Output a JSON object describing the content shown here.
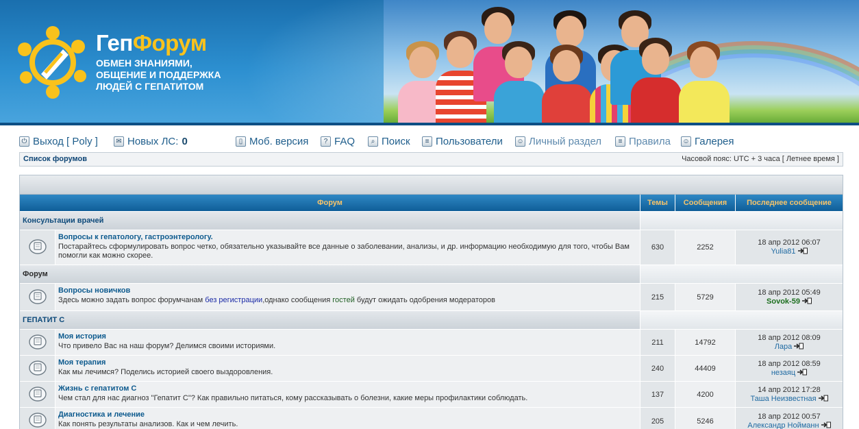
{
  "header": {
    "logo_prefix": "Геп",
    "logo_accent": "Форум",
    "tagline": [
      "ОБМЕН ЗНАНИЯМИ,",
      "ОБЩЕНИЕ И ПОДДЕРЖКА",
      "ЛЮДЕЙ С ГЕПАТИТОМ"
    ],
    "colors": {
      "brand_blue": "#1a6fae",
      "accent_yellow": "#f9c21c"
    }
  },
  "nav": {
    "logout_label": "Выход [ Poly ]",
    "pm_label": "Новых ЛС:",
    "pm_count": "0",
    "mobile_label": "Моб. версия",
    "faq_label": "FAQ",
    "search_label": "Поиск",
    "users_label": "Пользователи",
    "personal_label": "Личный раздел",
    "rules_label": "Правила",
    "gallery_label": "Галерея"
  },
  "breadcrumb": {
    "forum_list": "Список форумов",
    "timezone": "Часовой пояс: UTC + 3 часа [ Летнее время ]"
  },
  "table": {
    "headers": {
      "forum": "Форум",
      "topics": "Темы",
      "posts": "Сообщения",
      "last_post": "Последнее сообщение"
    },
    "categories": [
      {
        "name": "Консультации врачей"
      },
      {
        "name": "Форум"
      },
      {
        "name": "ГЕПАТИТ С"
      }
    ],
    "forums": [
      {
        "title": "Вопросы к гепатологу, гастроэнтерологу.",
        "desc": "Постарайтесь сформулировать вопрос четко, обязательно указывайте все данные о заболевании, анализы, и др. информацию необходимую для того, чтобы Вам помогли как можно скорее.",
        "topics": "630",
        "posts": "2252",
        "last_date": "18 апр 2012 06:07",
        "last_user": "Yulia81"
      },
      {
        "title": "Вопросы новичков",
        "desc_a": "Здесь можно задать вопрос форумчанам ",
        "desc_link": "без регистрации",
        "desc_b": ",однако сообщения ",
        "desc_guests": "гостей",
        "desc_c": " будут ожидать одобрения модераторов",
        "topics": "215",
        "posts": "5729",
        "last_date": "18 апр 2012 05:49",
        "last_user": "Sovok-59"
      },
      {
        "title": "Моя история",
        "desc": "Что привело Вас на наш форум? Делимся своими историями.",
        "topics": "211",
        "posts": "14792",
        "last_date": "18 апр 2012 08:09",
        "last_user": "Лара"
      },
      {
        "title": "Моя терапия",
        "desc": "Как мы лечимся? Поделись историей своего выздоровления.",
        "topics": "240",
        "posts": "44409",
        "last_date": "18 апр 2012 08:59",
        "last_user": "незаяц"
      },
      {
        "title": "Жизнь с гепатитом С",
        "desc": "Чем стал для нас диагноз \"Гепатит С\"? Как правильно питаться, кому рассказывать о болезни, какие меры профилактики соблюдать.",
        "topics": "137",
        "posts": "4200",
        "last_date": "14 апр 2012 17:28",
        "last_user": "Таша Неизвестная"
      },
      {
        "title": "Диагностика и лечение",
        "desc": "Как понять результаты анализов. Как и чем лечить.",
        "topics": "205",
        "posts": "5246",
        "last_date": "18 апр 2012 00:57",
        "last_user": "Александр Нойманн"
      }
    ]
  }
}
